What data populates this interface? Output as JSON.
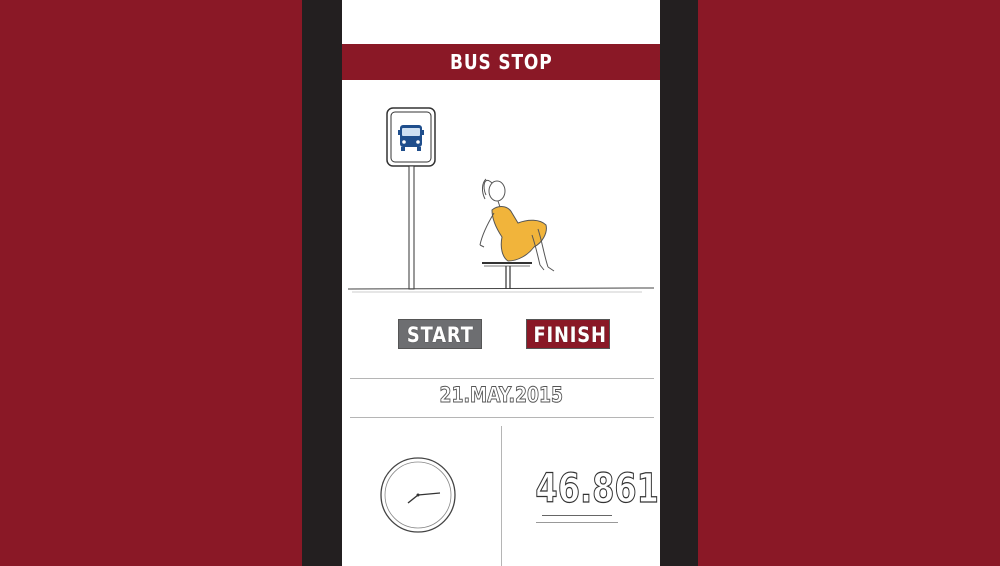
{
  "app": {
    "title": "BUS STOP"
  },
  "icons": {
    "bus_sign": "bus-stop-sign-icon",
    "clock": "analog-clock-icon"
  },
  "scene": {
    "figure": "woman-sitting-on-bench-illustration"
  },
  "controls": {
    "start_label": "START",
    "finish_label": "FINISH"
  },
  "info": {
    "date": "21.MAY.2015",
    "counter": "46.861"
  },
  "colors": {
    "brand": "#8a1826",
    "phone_frame": "#231f20",
    "start_button": "#6d6e71",
    "bus_icon": "#1f4e8c",
    "dress": "#f1b43b"
  }
}
